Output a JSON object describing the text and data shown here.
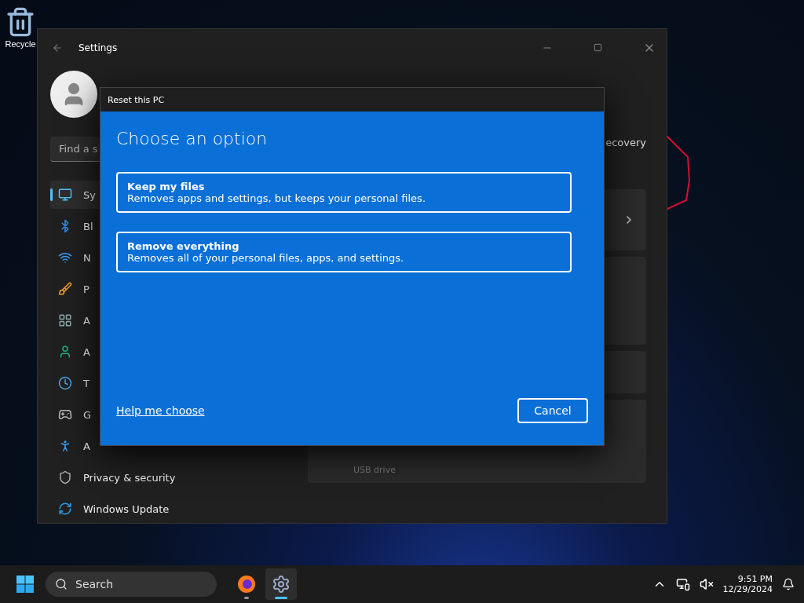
{
  "desktop": {
    "icons": [
      {
        "label": "Recycle"
      }
    ]
  },
  "settings_window": {
    "title": "Settings",
    "breadcrumb": "ecovery",
    "search": {
      "placeholder": "Find a s"
    },
    "sidebar": {
      "items": [
        {
          "kind": "system",
          "label": "Sy",
          "selected": true
        },
        {
          "kind": "bluetooth",
          "label": "Bl",
          "selected": false
        },
        {
          "kind": "network",
          "label": "N",
          "selected": false
        },
        {
          "kind": "personalization",
          "label": "P",
          "selected": false
        },
        {
          "kind": "apps",
          "label": "A",
          "selected": false
        },
        {
          "kind": "accounts",
          "label": "A",
          "selected": false
        },
        {
          "kind": "time",
          "label": "T",
          "selected": false
        },
        {
          "kind": "gaming",
          "label": "G",
          "selected": false
        },
        {
          "kind": "accessibility",
          "label": "A",
          "selected": false
        },
        {
          "kind": "privacy",
          "label": "Privacy & security",
          "selected": false
        },
        {
          "kind": "update",
          "label": "Windows Update",
          "selected": false
        }
      ]
    },
    "content": {
      "note": "USB drive"
    }
  },
  "dialog": {
    "title": "Reset this PC",
    "heading": "Choose an option",
    "options": [
      {
        "title": "Keep my files",
        "description": "Removes apps and settings, but keeps your personal files."
      },
      {
        "title": "Remove everything",
        "description": "Removes all of your personal files, apps, and settings."
      }
    ],
    "link": "Help me choose",
    "buttons": [
      "Cancel"
    ]
  },
  "taskbar": {
    "search": {
      "placeholder": "Search"
    },
    "apps": [
      {
        "kind": "browser",
        "selected": false
      },
      {
        "kind": "settings",
        "selected": true
      }
    ],
    "clock": {
      "time": "9:51 PM",
      "date": "12/29/2024"
    }
  }
}
